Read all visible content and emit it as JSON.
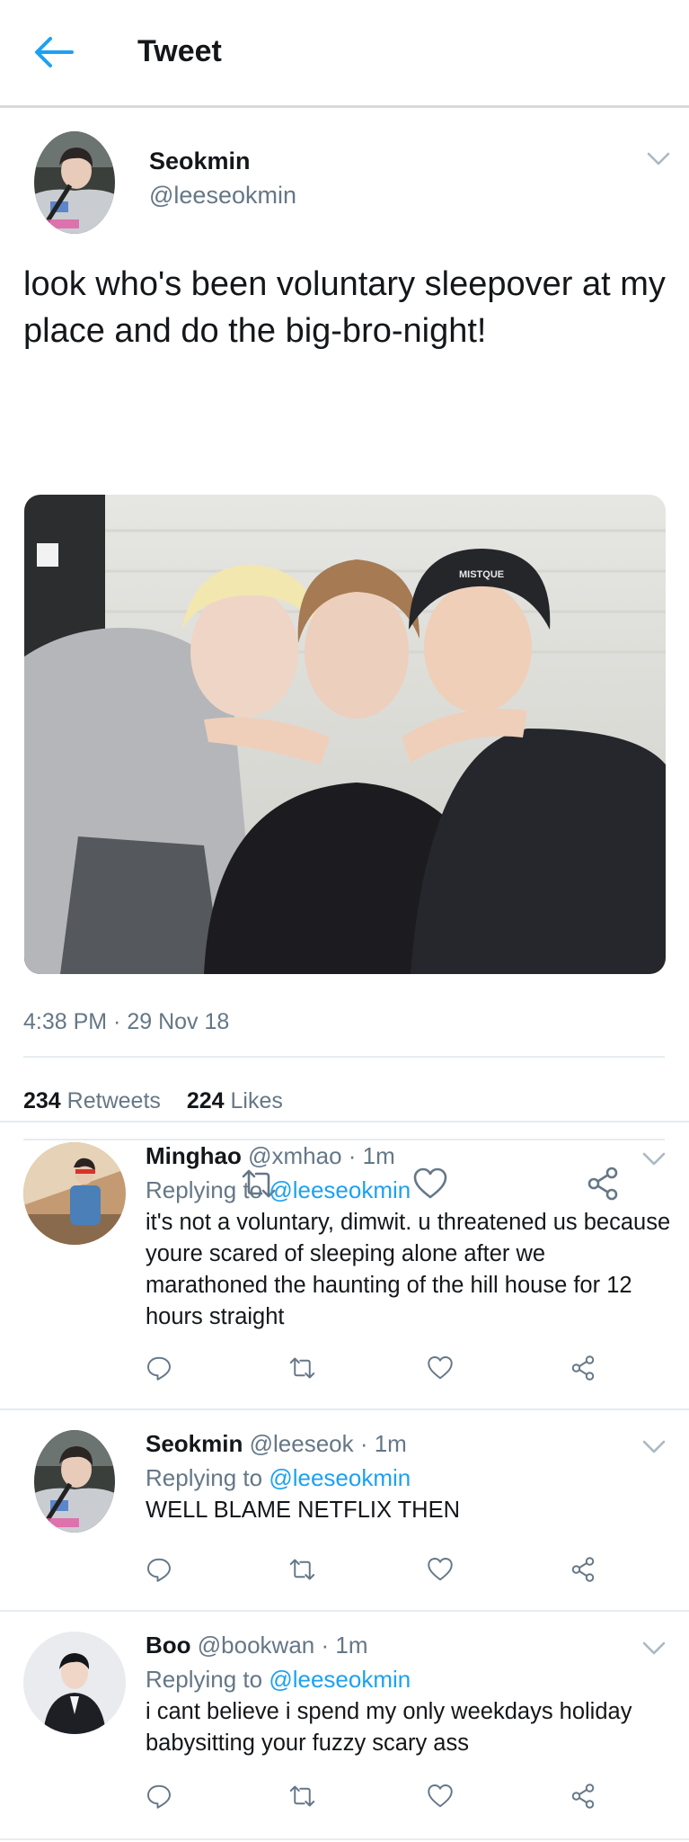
{
  "header": {
    "title": "Tweet",
    "back_icon": "arrow-left-icon"
  },
  "main_tweet": {
    "name": "Seokmin",
    "handle": "@leeseokmin",
    "text": "look who's been voluntary sleepover at my place and do the big-bro-night!",
    "timestamp": "4:38 PM · 29 Nov 18",
    "retweets_count": "234",
    "retweets_label": "Retweets",
    "likes_count": "224",
    "likes_label": "Likes",
    "beanie_text": "MISTQUE"
  },
  "replies": [
    {
      "name": "Minghao",
      "meta": "@xmhao · 1m",
      "replying_label": "Replying to",
      "replying_to": "@leeseokmin",
      "text": "it's not a voluntary, dimwit. u threatened us because youre scared of sleeping alone after we marathoned the haunting of the hill house for 12 hours straight"
    },
    {
      "name": "Seokmin",
      "meta": "@leeseok · 1m",
      "replying_label": "Replying to",
      "replying_to": "@leeseokmin",
      "text": "WELL BLAME NETFLIX THEN"
    },
    {
      "name": "Boo",
      "meta": "@bookwan · 1m",
      "replying_label": "Replying to",
      "replying_to": "@leeseokmin",
      "text": "i cant believe i spend my only weekdays holiday babysitting your fuzzy scary ass"
    }
  ],
  "icons": [
    "reply-icon",
    "retweet-icon",
    "like-icon",
    "share-icon",
    "chevron-down-icon"
  ],
  "colors": {
    "accent": "#1da1f2",
    "text": "#14171a",
    "secondary": "#657786",
    "divider": "#e6ecf0"
  }
}
